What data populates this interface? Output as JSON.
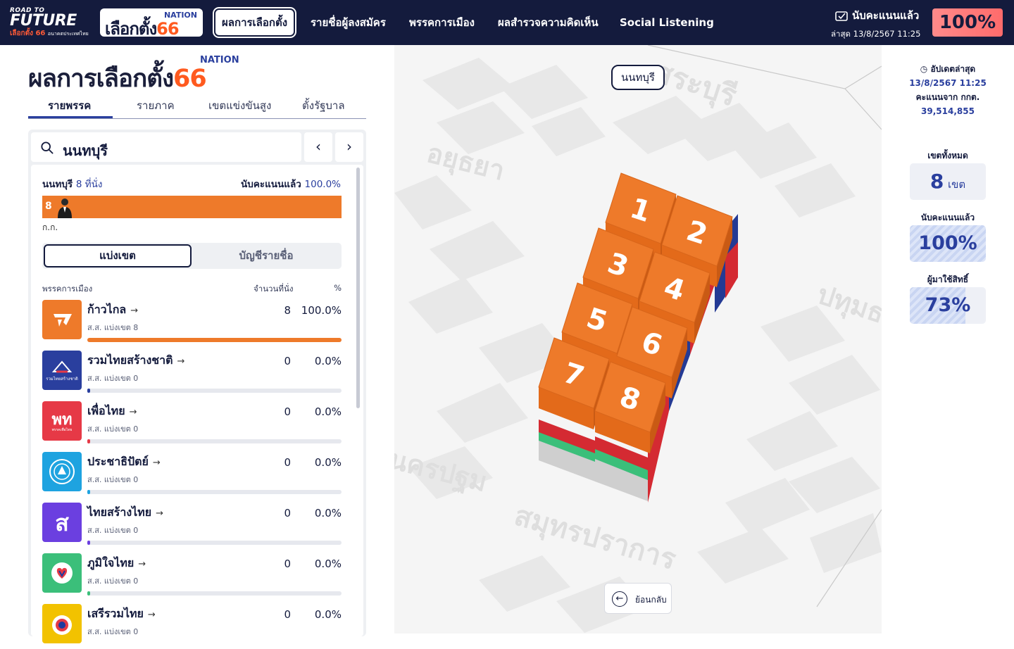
{
  "brand": {
    "line1": "ROAD TO",
    "line2": "FUTURE",
    "line3": "เลือกตั้ง 66",
    "line3_sub": "อนาคตประเทศไทย"
  },
  "logo66": {
    "nation": "NATION",
    "text": "เลือกตั้ง",
    "num": "66"
  },
  "nav": [
    {
      "label": "ผลการเลือกตั้ง",
      "active": true
    },
    {
      "label": "รายชื่อผู้ลงสมัคร"
    },
    {
      "label": "พรรคการเมือง"
    },
    {
      "label": "ผลสำรวจความคิดเห็น"
    },
    {
      "label": "Social Listening"
    }
  ],
  "count": {
    "label": "นับคะแนนแล้ว",
    "updated": "ล่าสุด 13/8/2567 11:25",
    "percent": "100%"
  },
  "title": {
    "text": "ผลการเลือกตั้ง",
    "num": "66",
    "nation": "NATION"
  },
  "tabs": [
    "รายพรรค",
    "รายภาค",
    "เขตแข่งขันสูง",
    "ตั้งรัฐบาล"
  ],
  "search": {
    "value": "นนทบุรี"
  },
  "province": {
    "name": "นนทบุรี",
    "seats": "8 ที่นั่ง",
    "counted_label": "นับคะแนนแล้ว",
    "counted_pct": "100.0%",
    "bar_seats": "8",
    "bar_party": "ก.ก."
  },
  "segment": {
    "a": "แบ่งเขต",
    "b": "บัญชีรายชื่อ"
  },
  "table_head": {
    "party": "พรรคการเมือง",
    "seats": "จำนวนที่นั่ง",
    "pct": "%"
  },
  "parties": [
    {
      "name": "ก้าวไกล",
      "sub": "ส.ส. แบ่งเขต 8",
      "seats": "8",
      "pct": "100.0%",
      "fill": 1.0,
      "color": "#ee7a2a"
    },
    {
      "name": "รวมไทยสร้างชาติ",
      "sub": "ส.ส. แบ่งเขต 0",
      "seats": "0",
      "pct": "0.0%",
      "fill": 0.0,
      "color": "#2a3f9e"
    },
    {
      "name": "เพื่อไทย",
      "sub": "ส.ส. แบ่งเขต 0",
      "seats": "0",
      "pct": "0.0%",
      "fill": 0.0,
      "color": "#e63946"
    },
    {
      "name": "ประชาธิปัตย์",
      "sub": "ส.ส. แบ่งเขต 0",
      "seats": "0",
      "pct": "0.0%",
      "fill": 0.0,
      "color": "#1ea3e0"
    },
    {
      "name": "ไทยสร้างไทย",
      "sub": "ส.ส. แบ่งเขต 0",
      "seats": "0",
      "pct": "0.0%",
      "fill": 0.0,
      "color": "#6b3fe0"
    },
    {
      "name": "ภูมิใจไทย",
      "sub": "ส.ส. แบ่งเขต 0",
      "seats": "0",
      "pct": "0.0%",
      "fill": 0.0,
      "color": "#3bbf7a"
    },
    {
      "name": "เสรีรวมไทย",
      "sub": "ส.ส. แบ่งเขต 0",
      "seats": "0",
      "pct": "0.0%",
      "fill": 0.0,
      "color": "#f2c200"
    }
  ],
  "party_logo_text": {
    "p2": "รวมไทยสร้างชาติ",
    "p3": "พท",
    "p3_sub": "พรรคเพื่อไทย",
    "p5": "ส"
  },
  "map": {
    "province_label": "นนทบุรี",
    "neighbors": [
      "สระบุรี",
      "อยุธยา",
      "ปทุมธานี",
      "นครปฐม",
      "สมุทรปราการ"
    ],
    "districts": [
      "1",
      "2",
      "3",
      "4",
      "5",
      "6",
      "7",
      "8"
    ],
    "back": "ย้อนกลับ"
  },
  "side": {
    "updated_label": "อัปเดตล่าสุด",
    "updated_time": "13/8/2567 11:25",
    "source": "คะแนนจาก กกต.",
    "votes": "39,514,855",
    "districts_label": "เขตทั้งหมด",
    "districts_value": "8",
    "districts_unit": "เขต",
    "counted_label": "นับคะแนนแล้ว",
    "counted_value": "100%",
    "turnout_label": "ผู้มาใช้สิทธิ์",
    "turnout_value": "73%",
    "turnout_fraction": 0.73
  },
  "colors": {
    "navy": "#141b3d",
    "orange": "#ee7a2a",
    "accent": "#ff5a1f",
    "blue": "#2a3f9e"
  }
}
